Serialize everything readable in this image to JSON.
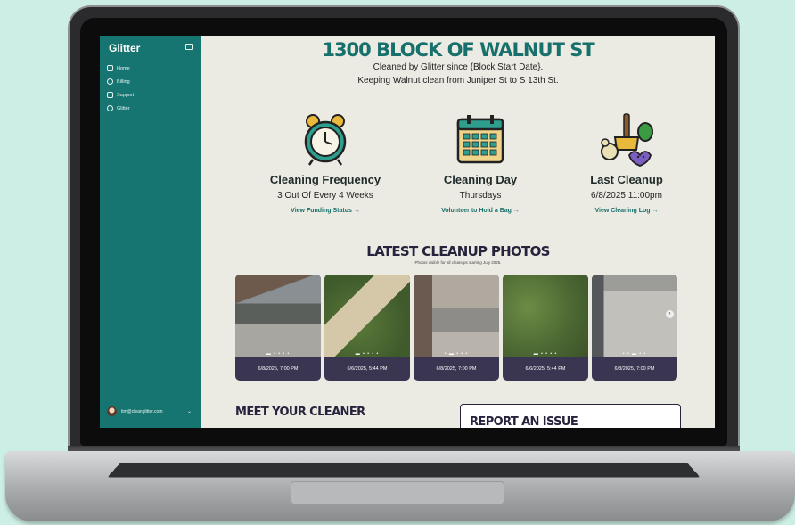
{
  "sidebar": {
    "brand": "Glitter",
    "items": [
      {
        "label": "Home",
        "icon": "home-icon"
      },
      {
        "label": "Billing",
        "icon": "billing-icon"
      },
      {
        "label": "Support",
        "icon": "support-icon"
      },
      {
        "label": "Glitter",
        "icon": "globe-icon"
      }
    ],
    "user_email": "tim@cleanglitter.com"
  },
  "hero": {
    "title": "1300 BLOCK OF WALNUT ST",
    "line1": "Cleaned by Glitter since {Block Start Date}.",
    "line2": "Keeping Walnut clean from Juniper St to S 13th St."
  },
  "stats": [
    {
      "title": "Cleaning Frequency",
      "value": "3 Out Of Every 4 Weeks",
      "link": "View Funding Status →",
      "icon": "alarm-clock-icon"
    },
    {
      "title": "Cleaning Day",
      "value": "Thursdays",
      "link": "Volunteer to Hold a Bag →",
      "icon": "calendar-icon"
    },
    {
      "title": "Last Cleanup",
      "value": "6/8/2025 11:00pm",
      "link": "View Cleaning Log →",
      "icon": "cleaning-supplies-icon"
    }
  ],
  "photos": {
    "title": "LATEST CLEANUP PHOTOS",
    "subtitle": "Photos visible for all cleanups starting July 2025.",
    "items": [
      {
        "caption": "6/8/2025, 7:00 PM"
      },
      {
        "caption": "6/6/2025, 5:44 PM"
      },
      {
        "caption": "6/8/2025, 7:00 PM"
      },
      {
        "caption": "6/6/2025, 5:44 PM"
      },
      {
        "caption": "6/8/2025, 7:00 PM"
      }
    ]
  },
  "meet": {
    "title": "MEET YOUR CLEANER"
  },
  "report": {
    "title": "REPORT AN ISSUE"
  },
  "colors": {
    "brand_teal": "#167570",
    "dark_purple": "#27233d",
    "page_bg": "#ecebe3"
  }
}
